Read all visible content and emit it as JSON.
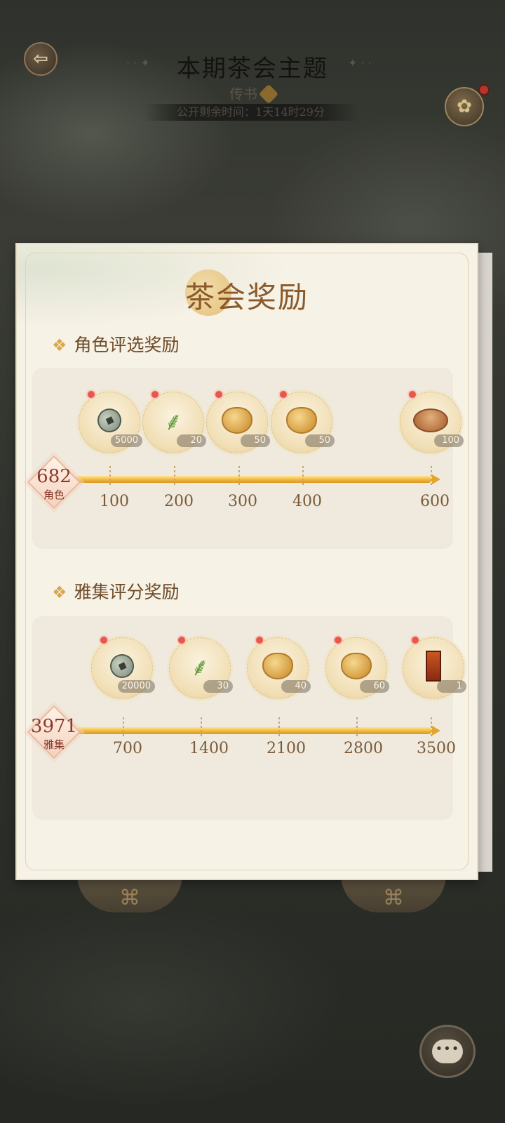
{
  "header": {
    "title": "本期茶会主题",
    "subtitle": "传书",
    "countdown": "公开剩余时间：1天14时29分",
    "back_icon": "back-arrow-icon",
    "lotus_icon": "lotus-icon"
  },
  "panel": {
    "title": "茶会奖励"
  },
  "role_section": {
    "title": "角色评选奖励",
    "score": "682",
    "score_label": "角色",
    "progress": 1.0,
    "ticks": [
      "100",
      "200",
      "300",
      "400",
      "600"
    ],
    "rewards": [
      {
        "icon": "copper-coin-icon",
        "count": "5000"
      },
      {
        "icon": "tea-leaf-icon",
        "count": "20"
      },
      {
        "icon": "gold-cloud-icon",
        "count": "50"
      },
      {
        "icon": "gold-cloud-icon",
        "count": "50"
      },
      {
        "icon": "mooncake-icon",
        "count": "100"
      }
    ]
  },
  "gathering_section": {
    "title": "雅集评分奖励",
    "score": "3971",
    "score_label": "雅集",
    "progress": 1.0,
    "ticks": [
      "700",
      "1400",
      "2100",
      "2800",
      "3500"
    ],
    "rewards": [
      {
        "icon": "copper-coin-icon",
        "count": "20000"
      },
      {
        "icon": "tea-leaf-icon",
        "count": "30"
      },
      {
        "icon": "gold-cloud-icon",
        "count": "40"
      },
      {
        "icon": "gold-cloud-icon",
        "count": "60"
      },
      {
        "icon": "book-scroll-icon",
        "count": "1"
      }
    ]
  },
  "chat": {
    "icon": "chat-bubble-icon"
  },
  "colors": {
    "accent_gold": "#f0b736",
    "badge_red": "#e8574a",
    "title_brown": "#8a5a2a"
  }
}
